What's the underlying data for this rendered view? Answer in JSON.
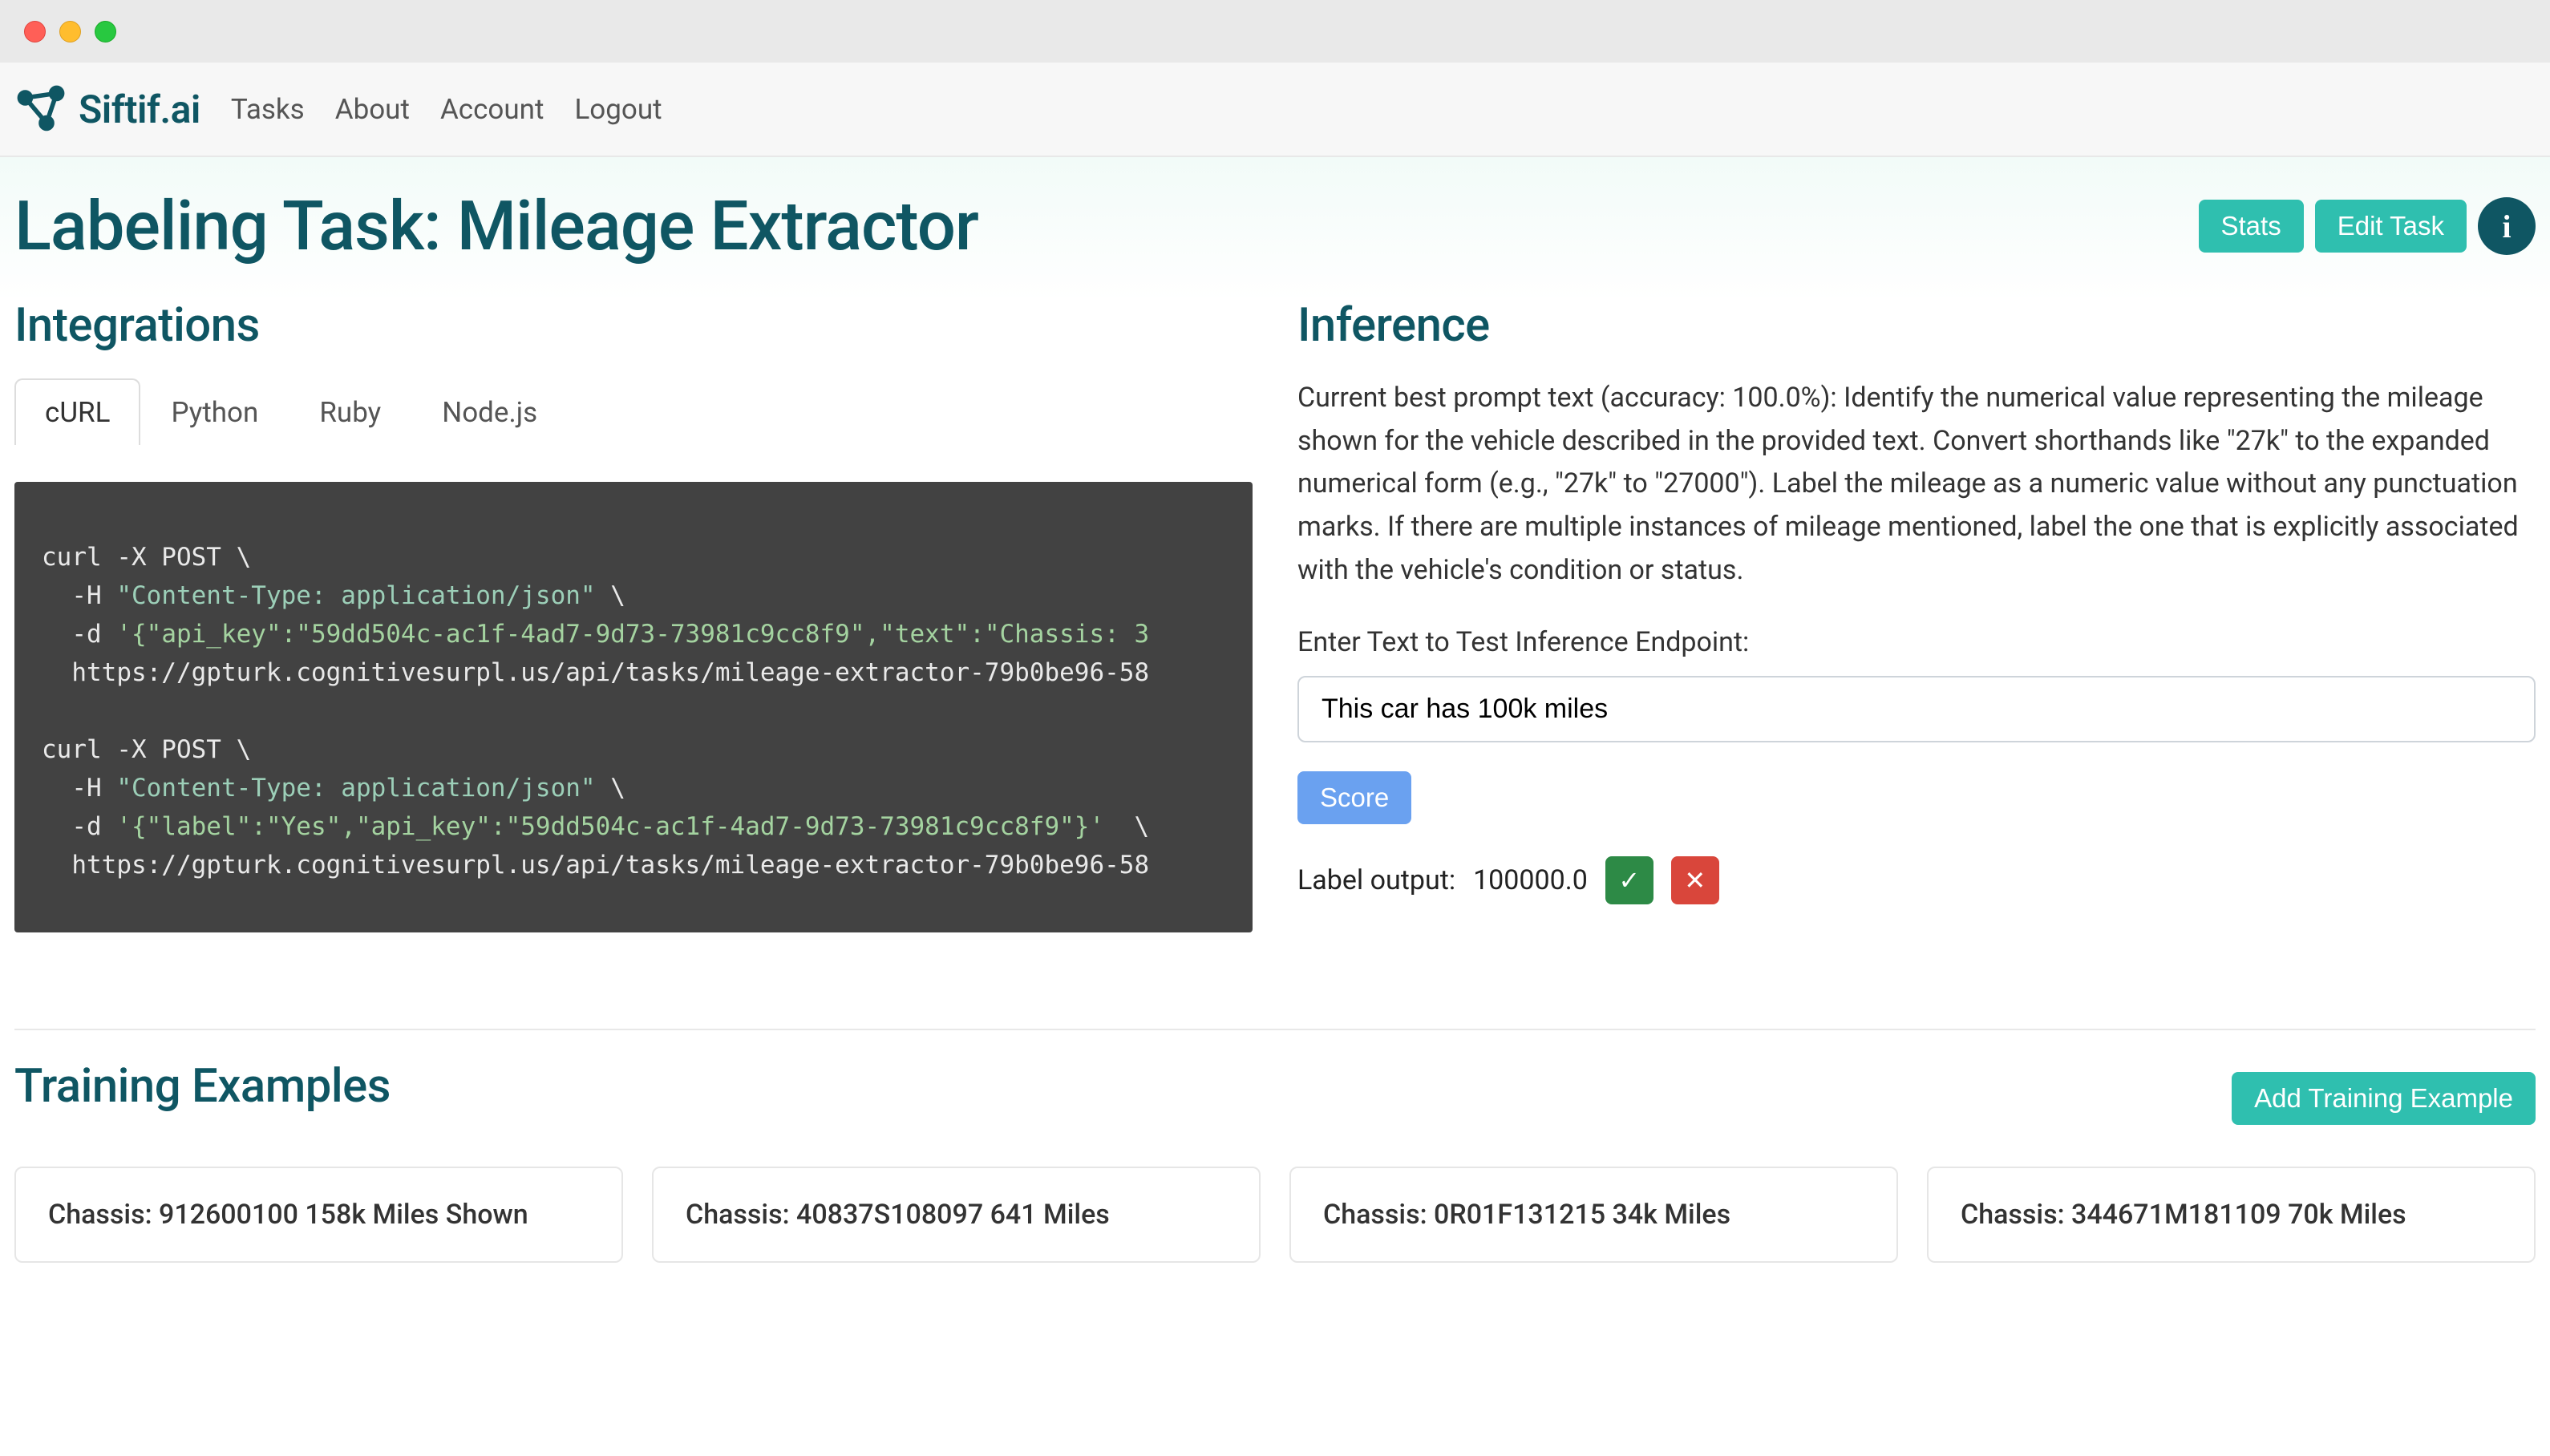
{
  "brand": "Siftif.ai",
  "nav": {
    "tasks": "Tasks",
    "about": "About",
    "account": "Account",
    "logout": "Logout"
  },
  "page_title": "Labeling Task: Mileage Extractor",
  "actions": {
    "stats": "Stats",
    "edit_task": "Edit Task",
    "info": "i",
    "add_example": "Add Training Example",
    "score": "Score"
  },
  "sections": {
    "integrations": "Integrations",
    "inference": "Inference",
    "training": "Training Examples"
  },
  "tabs": {
    "curl": "cURL",
    "python": "Python",
    "ruby": "Ruby",
    "node": "Node.js"
  },
  "code": {
    "l1": "curl -X POST \\",
    "l2a": "  -H ",
    "l2b": "\"Content-Type: application/json\"",
    "l2c": " \\",
    "l3a": "  -d ",
    "l3b": "'{\"api_key\":\"59dd504c-ac1f-4ad7-9d73-73981c9cc8f9\",\"text\":\"Chassis: 3",
    "l4": "  https://gpturk.cognitivesurpl.us/api/tasks/mileage-extractor-79b0be96-58",
    "l5": "",
    "l6": "curl -X POST \\",
    "l7a": "  -H ",
    "l7b": "\"Content-Type: application/json\"",
    "l7c": " \\",
    "l8a": "  -d ",
    "l8b": "'{\"label\":\"Yes\",\"api_key\":\"59dd504c-ac1f-4ad7-9d73-73981c9cc8f9\"}'",
    "l8c": "  \\",
    "l9": "  https://gpturk.cognitivesurpl.us/api/tasks/mileage-extractor-79b0be96-58"
  },
  "inference": {
    "accuracy": "100.0%",
    "prompt_full": "Current best prompt text (accuracy: 100.0%): Identify the numerical value representing the mileage shown for the vehicle described in the provided text. Convert shorthands like \"27k\" to the expanded numerical form (e.g., \"27k\" to \"27000\"). Label the mileage as a numeric value without any punctuation marks. If there are multiple instances of mileage mentioned, label the one that is explicitly associated with the vehicle's condition or status.",
    "input_label": "Enter Text to Test Inference Endpoint:",
    "input_value": "This car has 100k miles",
    "output_label": "Label output:",
    "output_value": "100000.0",
    "check": "✓",
    "cross": "✕"
  },
  "training_examples": [
    "Chassis: 912600100 158k Miles Shown",
    "Chassis: 40837S108097 641 Miles",
    "Chassis: 0R01F131215 34k Miles",
    "Chassis: 344671M181109 70k Miles"
  ]
}
